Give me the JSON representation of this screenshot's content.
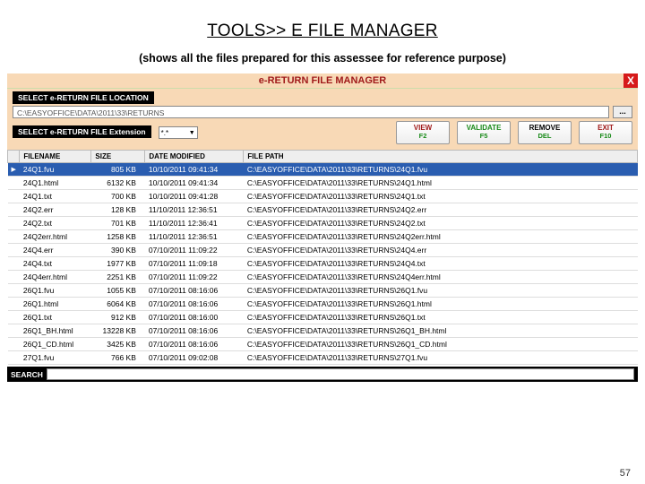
{
  "slide": {
    "title": "TOOLS>> E FILE MANAGER",
    "subtitle": "(shows all the files prepared for this assessee for reference purpose)"
  },
  "app": {
    "header": "e-RETURN FILE MANAGER",
    "close": "X",
    "location_label": "SELECT e-RETURN FILE LOCATION",
    "location_value": "C:\\EASYOFFICE\\DATA\\2011\\33\\RETURNS",
    "browse": "...",
    "ext_label": "SELECT e-RETURN FILE Extension",
    "ext_value": "*.*",
    "buttons": {
      "view": {
        "line1": "VIEW",
        "line2": "F2"
      },
      "validate": {
        "line1": "VALIDATE",
        "line2": "F5"
      },
      "remove": {
        "line1": "REMOVE",
        "line2": "DEL"
      },
      "exit": {
        "line1": "EXIT",
        "line2": "F10"
      }
    }
  },
  "grid": {
    "columns": [
      "",
      "FILENAME",
      "SIZE",
      "DATE MODIFIED",
      "FILE PATH"
    ],
    "rows": [
      {
        "sel": true,
        "name": "24Q1.fvu",
        "size": "805 KB",
        "date": "10/10/2011 09:41:34",
        "path": "C:\\EASYOFFICE\\DATA\\2011\\33\\RETURNS\\24Q1.fvu"
      },
      {
        "sel": false,
        "name": "24Q1.html",
        "size": "6132 KB",
        "date": "10/10/2011 09:41:34",
        "path": "C:\\EASYOFFICE\\DATA\\2011\\33\\RETURNS\\24Q1.html"
      },
      {
        "sel": false,
        "name": "24Q1.txt",
        "size": "700 KB",
        "date": "10/10/2011 09:41:28",
        "path": "C:\\EASYOFFICE\\DATA\\2011\\33\\RETURNS\\24Q1.txt"
      },
      {
        "sel": false,
        "name": "24Q2.err",
        "size": "128 KB",
        "date": "11/10/2011 12:36:51",
        "path": "C:\\EASYOFFICE\\DATA\\2011\\33\\RETURNS\\24Q2.err"
      },
      {
        "sel": false,
        "name": "24Q2.txt",
        "size": "701 KB",
        "date": "11/10/2011 12:36:41",
        "path": "C:\\EASYOFFICE\\DATA\\2011\\33\\RETURNS\\24Q2.txt"
      },
      {
        "sel": false,
        "name": "24Q2err.html",
        "size": "1258 KB",
        "date": "11/10/2011 12:36:51",
        "path": "C:\\EASYOFFICE\\DATA\\2011\\33\\RETURNS\\24Q2err.html"
      },
      {
        "sel": false,
        "name": "24Q4.err",
        "size": "390 KB",
        "date": "07/10/2011 11:09:22",
        "path": "C:\\EASYOFFICE\\DATA\\2011\\33\\RETURNS\\24Q4.err"
      },
      {
        "sel": false,
        "name": "24Q4.txt",
        "size": "1977 KB",
        "date": "07/10/2011 11:09:18",
        "path": "C:\\EASYOFFICE\\DATA\\2011\\33\\RETURNS\\24Q4.txt"
      },
      {
        "sel": false,
        "name": "24Q4err.html",
        "size": "2251 KB",
        "date": "07/10/2011 11:09:22",
        "path": "C:\\EASYOFFICE\\DATA\\2011\\33\\RETURNS\\24Q4err.html"
      },
      {
        "sel": false,
        "name": "26Q1.fvu",
        "size": "1055 KB",
        "date": "07/10/2011 08:16:06",
        "path": "C:\\EASYOFFICE\\DATA\\2011\\33\\RETURNS\\26Q1.fvu"
      },
      {
        "sel": false,
        "name": "26Q1.html",
        "size": "6064 KB",
        "date": "07/10/2011 08:16:06",
        "path": "C:\\EASYOFFICE\\DATA\\2011\\33\\RETURNS\\26Q1.html"
      },
      {
        "sel": false,
        "name": "26Q1.txt",
        "size": "912 KB",
        "date": "07/10/2011 08:16:00",
        "path": "C:\\EASYOFFICE\\DATA\\2011\\33\\RETURNS\\26Q1.txt"
      },
      {
        "sel": false,
        "name": "26Q1_BH.html",
        "size": "13228 KB",
        "date": "07/10/2011 08:16:06",
        "path": "C:\\EASYOFFICE\\DATA\\2011\\33\\RETURNS\\26Q1_BH.html"
      },
      {
        "sel": false,
        "name": "26Q1_CD.html",
        "size": "3425 KB",
        "date": "07/10/2011 08:16:06",
        "path": "C:\\EASYOFFICE\\DATA\\2011\\33\\RETURNS\\26Q1_CD.html"
      },
      {
        "sel": false,
        "name": "27Q1.fvu",
        "size": "766 KB",
        "date": "07/10/2011 09:02:08",
        "path": "C:\\EASYOFFICE\\DATA\\2011\\33\\RETURNS\\27Q1.fvu"
      }
    ]
  },
  "search_label": "SEARCH",
  "page_number": "57"
}
